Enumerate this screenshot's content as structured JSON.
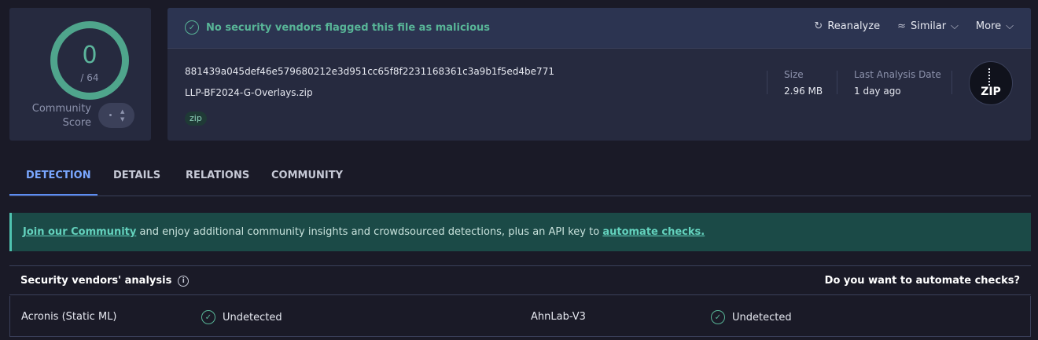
{
  "score": {
    "detections": "0",
    "total": "/ 64",
    "community_label_line1": "Community",
    "community_label_line2": "Score",
    "accent_color": "#4fa58c"
  },
  "header": {
    "status_text": "No security vendors flagged this file as malicious",
    "actions": {
      "reanalyze": "Reanalyze",
      "similar": "Similar",
      "more": "More"
    }
  },
  "file": {
    "hash": "881439a045def46e579680212e3d951cc65f8f2231168361c3a9b1f5ed4be771",
    "name": "LLP-BF2024-G-Overlays.zip",
    "tag": "zip",
    "size_label": "Size",
    "size_value": "2.96 MB",
    "date_label": "Last Analysis Date",
    "date_value": "1 day ago",
    "type_badge": "ZIP"
  },
  "tabs": [
    "DETECTION",
    "DETAILS",
    "RELATIONS",
    "COMMUNITY"
  ],
  "banner": {
    "link1": "Join our Community",
    "middle": " and enjoy additional community insights and crowdsourced detections, plus an API key to ",
    "link2": "automate checks."
  },
  "vendors": {
    "title": "Security vendors' analysis",
    "automate_prompt": "Do you want to automate checks?",
    "rows": [
      {
        "vendor1": "Acronis (Static ML)",
        "result1": "Undetected",
        "vendor2": "AhnLab-V3",
        "result2": "Undetected"
      }
    ]
  }
}
